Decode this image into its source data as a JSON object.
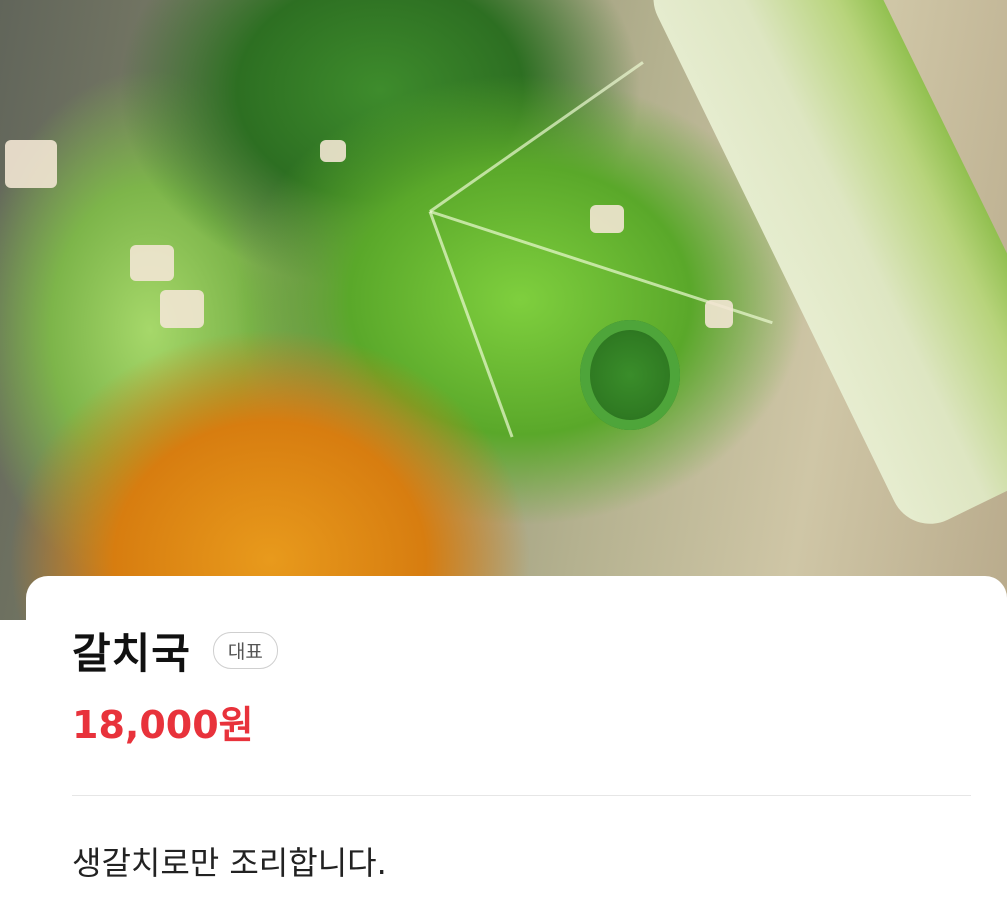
{
  "photo": {
    "alt": "갈치국 사진"
  },
  "menu": {
    "name": "갈치국",
    "badge": "대표",
    "price": "18,000원",
    "description": "생갈치로만 조리합니다."
  },
  "colors": {
    "price": "#e8323b",
    "badge_border": "#cfcfcf",
    "text": "#111111"
  }
}
